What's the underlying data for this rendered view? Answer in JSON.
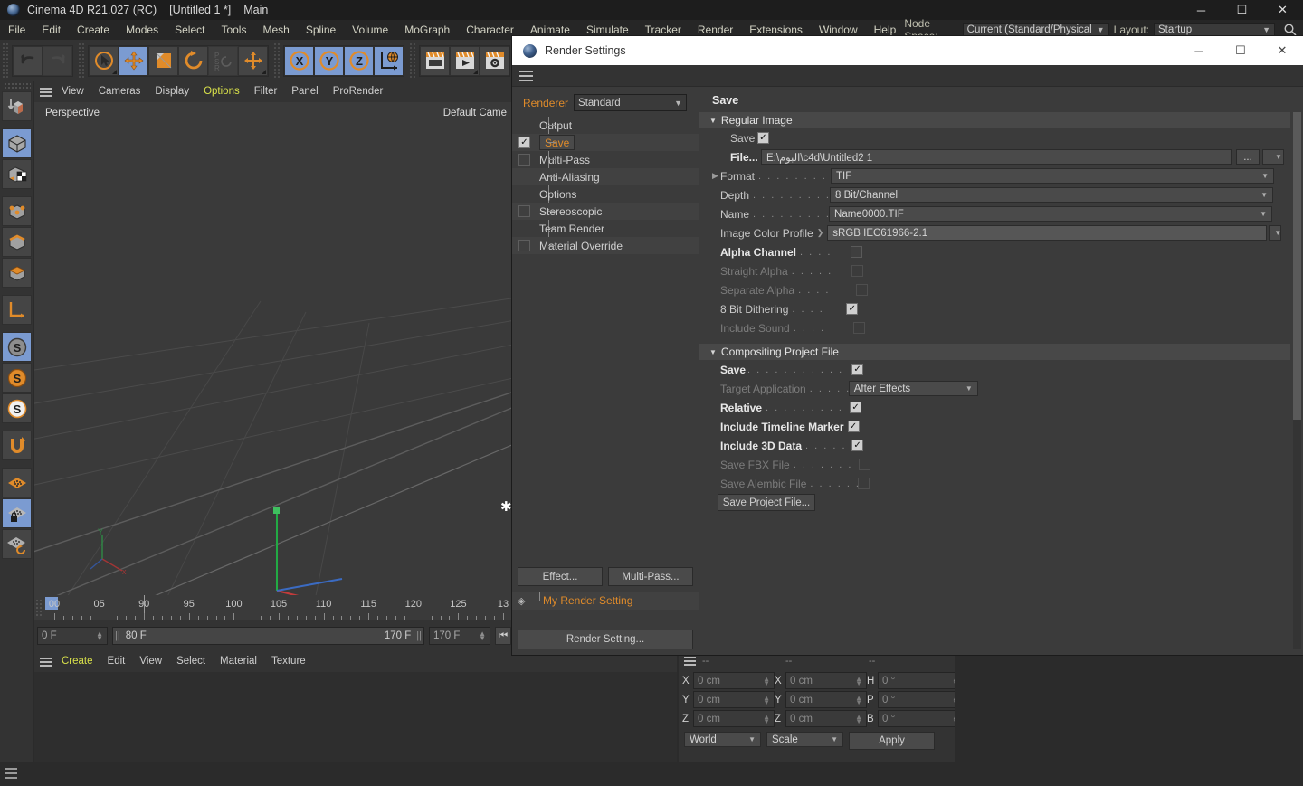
{
  "window": {
    "title": "Cinema 4D R21.027 (RC)",
    "document": "[Untitled 1 *]",
    "layout_name": "Main",
    "minimize": "─",
    "maximize": "☐",
    "close": "✕"
  },
  "menubar": {
    "items": [
      "File",
      "Edit",
      "Create",
      "Modes",
      "Select",
      "Tools",
      "Mesh",
      "Spline",
      "Volume",
      "MoGraph",
      "Character",
      "Animate",
      "Simulate",
      "Tracker",
      "Render",
      "Extensions",
      "Window",
      "Help"
    ],
    "node_space_label": "Node Space:",
    "node_space_value": "Current (Standard/Physical)",
    "layout_label": "Layout:",
    "layout_value": "Startup"
  },
  "toolbar": {
    "undo": "undo-icon",
    "redo": "redo-icon",
    "select": "select-arrow-icon",
    "move": "move-icon",
    "scale": "scale-icon",
    "rotate": "rotate-icon",
    "psr": "psr-icon",
    "move_dup": "move-axis-icon",
    "axis_x": "X",
    "axis_y": "Y",
    "axis_z": "Z",
    "world_axis": "world-axis-icon",
    "render_view": "render-view-icon",
    "render_picture": "render-picture-icon",
    "render_settings": "render-settings-icon"
  },
  "left_toolbar": {
    "items": [
      "make-editable-icon",
      "model-mode-icon",
      "texture-mode-icon",
      "points-mode-icon",
      "edges-mode-icon",
      "polygons-mode-icon",
      "axis-mode-icon",
      "object-axis-icon",
      "enable-axis-icon",
      "world-object-icon",
      "snap-icon",
      "workplane-icon",
      "workplane-lock-icon",
      "workplane-toggle-icon"
    ]
  },
  "viewport": {
    "menu": [
      "View",
      "Cameras",
      "Display",
      "Options",
      "Filter",
      "Panel",
      "ProRender"
    ],
    "menu_highlighted": "Options",
    "label": "Perspective",
    "camera": "Default Came"
  },
  "timeline": {
    "tick_labels": [
      "00",
      "05",
      "90",
      "95",
      "100",
      "105",
      "110",
      "115",
      "120",
      "125",
      "13"
    ],
    "current_frame": "0 F",
    "range_start": "80 F",
    "range_end": "170 F",
    "max_frame": "170 F"
  },
  "material_manager": {
    "menu": [
      "Create",
      "Edit",
      "View",
      "Select",
      "Material",
      "Texture"
    ],
    "menu_highlighted": "Create"
  },
  "coordinates": {
    "headers": [
      "--",
      "--",
      "--"
    ],
    "position": {
      "axes": [
        "X",
        "Y",
        "Z"
      ],
      "values": [
        "0 cm",
        "0 cm",
        "0 cm"
      ]
    },
    "size": {
      "axes": [
        "X",
        "Y",
        "Z"
      ],
      "values": [
        "0 cm",
        "0 cm",
        "0 cm"
      ]
    },
    "rotation": {
      "axes": [
        "H",
        "P",
        "B"
      ],
      "values": [
        "0 °",
        "0 °",
        "0 °"
      ]
    },
    "coord_system": "World",
    "mode": "Scale",
    "apply_label": "Apply"
  },
  "render_settings": {
    "title": "Render Settings",
    "minimize": "─",
    "maximize": "☐",
    "close": "✕",
    "renderer_label": "Renderer",
    "renderer_value": "Standard",
    "tree": [
      {
        "label": "Output",
        "checkbox": "none",
        "selected": false
      },
      {
        "label": "Save",
        "checkbox": "checked",
        "selected": true
      },
      {
        "label": "Multi-Pass",
        "checkbox": "empty",
        "selected": false
      },
      {
        "label": "Anti-Aliasing",
        "checkbox": "none",
        "selected": false
      },
      {
        "label": "Options",
        "checkbox": "none",
        "selected": false
      },
      {
        "label": "Stereoscopic",
        "checkbox": "empty",
        "selected": false
      },
      {
        "label": "Team Render",
        "checkbox": "none",
        "selected": false
      },
      {
        "label": "Material Override",
        "checkbox": "empty",
        "selected": false
      }
    ],
    "effect_button": "Effect...",
    "multipass_button": "Multi-Pass...",
    "setting_name": "My Render Setting",
    "render_setting_button": "Render Setting...",
    "page_title": "Save",
    "regular_image": {
      "group_title": "Regular Image",
      "save_label": "Save",
      "save_checked": true,
      "file_label": "File...",
      "file_value": "E:\\البوم\\c4d\\Untitled2 1",
      "file_browse": "...",
      "format_label": "Format",
      "format_value": "TIF",
      "depth_label": "Depth",
      "depth_value": "8 Bit/Channel",
      "name_label": "Name",
      "name_value": "Name0000.TIF",
      "color_profile_label": "Image Color Profile",
      "color_profile_value": "sRGB IEC61966-2.1",
      "alpha_channel_label": "Alpha Channel",
      "alpha_channel_checked": false,
      "straight_alpha_label": "Straight Alpha",
      "straight_alpha_checked": false,
      "separate_alpha_label": "Separate Alpha",
      "separate_alpha_checked": false,
      "dithering_label": "8 Bit Dithering",
      "dithering_checked": true,
      "include_sound_label": "Include Sound",
      "include_sound_checked": false
    },
    "compositing": {
      "group_title": "Compositing Project File",
      "save_label": "Save",
      "save_checked": true,
      "target_app_label": "Target Application",
      "target_app_value": "After Effects",
      "relative_label": "Relative",
      "relative_checked": true,
      "timeline_marker_label": "Include Timeline Marker",
      "timeline_marker_checked": true,
      "include_3d_label": "Include 3D Data",
      "include_3d_checked": true,
      "fbx_label": "Save FBX File",
      "fbx_checked": false,
      "alembic_label": "Save Alembic File",
      "alembic_checked": false,
      "save_project_button": "Save Project File..."
    }
  }
}
